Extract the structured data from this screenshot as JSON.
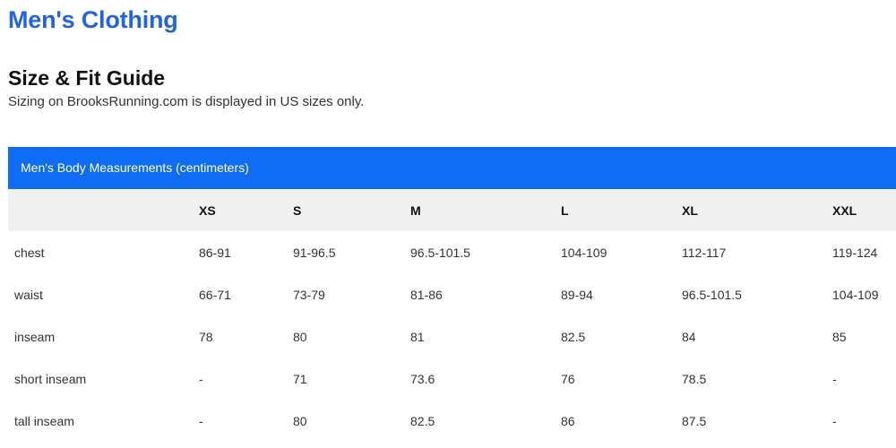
{
  "page_title": "Men's Clothing",
  "guide": {
    "title": "Size & Fit Guide",
    "subtitle": "Sizing on BrooksRunning.com is displayed in US sizes only."
  },
  "table": {
    "caption": "Men's Body Measurements (centimeters)",
    "header_color": "#0f6cf5",
    "columns": [
      "",
      "XS",
      "S",
      "M",
      "L",
      "XL",
      "XXL"
    ],
    "rows": [
      {
        "label": "chest",
        "cells": [
          "86-91",
          "91-96.5",
          "96.5-101.5",
          "104-109",
          "112-117",
          "119-124"
        ]
      },
      {
        "label": "waist",
        "cells": [
          "66-71",
          "73-79",
          "81-86",
          "89-94",
          "96.5-101.5",
          "104-109"
        ]
      },
      {
        "label": "inseam",
        "cells": [
          "78",
          "80",
          "81",
          "82.5",
          "84",
          "85"
        ]
      },
      {
        "label": "short inseam",
        "cells": [
          "-",
          "71",
          "73.6",
          "76",
          "78.5",
          "-"
        ]
      },
      {
        "label": "tall inseam",
        "cells": [
          "-",
          "80",
          "82.5",
          "86",
          "87.5",
          "-"
        ]
      }
    ]
  },
  "colors": {
    "title_blue": "#1f63e6",
    "header_row_bg": "#f0f0f0"
  }
}
